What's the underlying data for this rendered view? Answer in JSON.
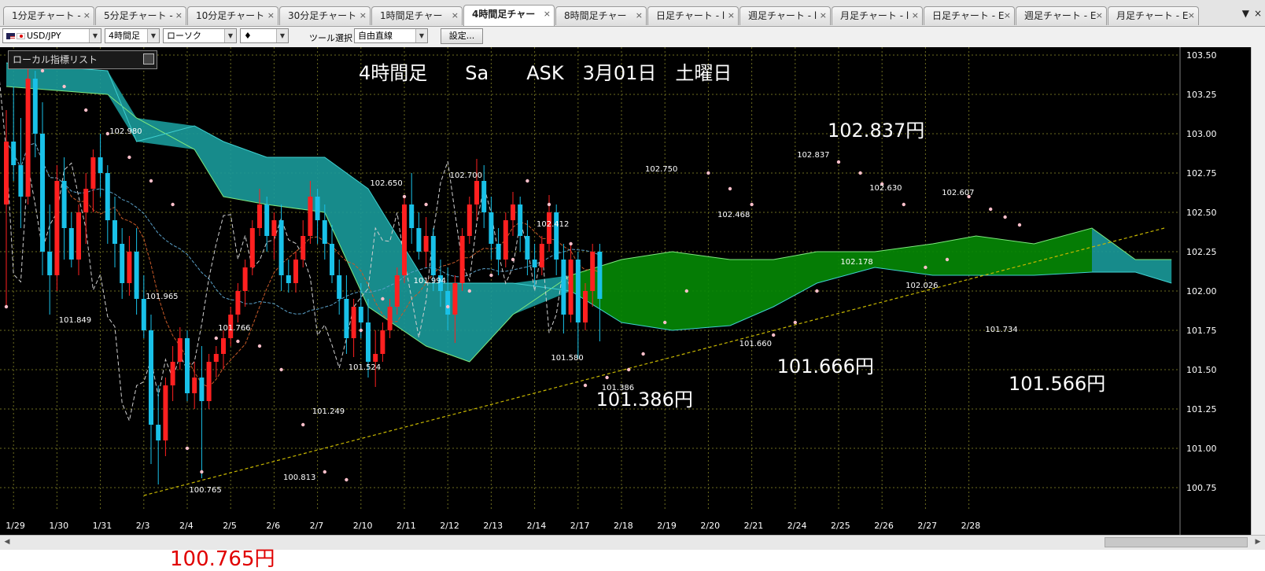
{
  "tabs": [
    {
      "label": "1分足チャート -",
      "active": false
    },
    {
      "label": "5分足チャート -",
      "active": false
    },
    {
      "label": "10分足チャート",
      "active": false
    },
    {
      "label": "30分足チャート",
      "active": false
    },
    {
      "label": "1時間足チャー",
      "active": false
    },
    {
      "label": "4時間足チャー",
      "active": true
    },
    {
      "label": "8時間足チャー",
      "active": false
    },
    {
      "label": "日足チャート - l",
      "active": false
    },
    {
      "label": "週足チャート - l",
      "active": false
    },
    {
      "label": "月足チャート - l",
      "active": false
    },
    {
      "label": "日足チャート - E",
      "active": false
    },
    {
      "label": "週足チャート - E",
      "active": false
    },
    {
      "label": "月足チャート - E",
      "active": false
    }
  ],
  "tab_close_glyph": "×",
  "tab_menu": {
    "menu_glyph": "▼",
    "close_glyph": "×"
  },
  "toolbar": {
    "pair": "USD/JPY",
    "timeframe": "4時間足",
    "chart_style": "ローソク",
    "marker": "♦",
    "tool_label": "ツール選択",
    "tool_value": "自由直線",
    "settings_label": "設定..."
  },
  "indicator_list": {
    "label": "ローカル指標リスト"
  },
  "below_chart_label": "100.765円",
  "colors": {
    "background": "#000000",
    "grid": "#6b6b1f",
    "candle_up": "#ff2020",
    "candle_down": "#19c1e8",
    "kumo_bearish": "#1a9a9a",
    "kumo_bullish": "#058a05",
    "sar": "#ffc0cb",
    "trendline": "#c8b800"
  },
  "chart_data": {
    "type": "candlestick",
    "title": "4時間足　　Sa　　ASK　3月01日　土曜日",
    "ylim": [
      100.6,
      103.55
    ],
    "yticks": [
      103.5,
      103.25,
      103.0,
      102.75,
      102.5,
      102.25,
      102.0,
      101.75,
      101.5,
      101.25,
      101.0,
      100.75
    ],
    "ytick_labels": [
      "103.50",
      "103.25",
      "103.00",
      "102.75",
      "102.50",
      "102.25",
      "102.00",
      "101.75",
      "101.50",
      "101.25",
      "101.00",
      "100.75"
    ],
    "xtick_labels": [
      "1/29",
      "1/30",
      "1/31",
      "2/3",
      "2/4",
      "2/5",
      "2/6",
      "2/7",
      "2/10",
      "2/11",
      "2/12",
      "2/13",
      "2/14",
      "2/17",
      "2/18",
      "2/19",
      "2/20",
      "2/21",
      "2/24",
      "2/25",
      "2/26",
      "2/27",
      "2/28"
    ],
    "xtick_pos": [
      1,
      7,
      13,
      19,
      25,
      31,
      37,
      43,
      49,
      55,
      61,
      67,
      73,
      79,
      85,
      91,
      97,
      103,
      109,
      115,
      121,
      127,
      133
    ],
    "ohlc": [
      [
        102.55,
        103.15,
        101.9,
        102.95
      ],
      [
        102.95,
        103.3,
        102.7,
        102.8
      ],
      [
        102.8,
        103.1,
        102.4,
        102.6
      ],
      [
        102.6,
        103.45,
        102.55,
        103.35
      ],
      [
        103.35,
        103.4,
        102.85,
        103.0
      ],
      [
        103.0,
        103.2,
        102.1,
        102.25
      ],
      [
        102.25,
        102.55,
        101.85,
        102.1
      ],
      [
        102.1,
        102.8,
        102.0,
        102.7
      ],
      [
        102.7,
        102.85,
        102.2,
        102.4
      ],
      [
        102.4,
        102.5,
        102.15,
        102.2
      ],
      [
        102.2,
        102.55,
        102.1,
        102.5
      ],
      [
        102.5,
        102.75,
        102.3,
        102.65
      ],
      [
        102.65,
        102.9,
        102.5,
        102.85
      ],
      [
        102.85,
        103.0,
        102.6,
        102.75
      ],
      [
        102.75,
        102.8,
        102.3,
        102.45
      ],
      [
        102.45,
        102.6,
        102.15,
        102.3
      ],
      [
        102.3,
        102.4,
        101.95,
        102.05
      ],
      [
        102.05,
        102.35,
        101.97,
        102.25
      ],
      [
        102.25,
        102.4,
        101.85,
        101.95
      ],
      [
        101.95,
        102.1,
        101.7,
        101.75
      ],
      [
        101.75,
        101.85,
        100.9,
        101.15
      ],
      [
        101.15,
        101.4,
        100.77,
        101.05
      ],
      [
        101.05,
        101.45,
        100.95,
        101.4
      ],
      [
        101.4,
        101.65,
        101.3,
        101.55
      ],
      [
        101.55,
        101.77,
        101.5,
        101.7
      ],
      [
        101.7,
        101.75,
        101.3,
        101.35
      ],
      [
        101.35,
        101.55,
        101.25,
        101.45
      ],
      [
        101.45,
        101.65,
        100.81,
        101.3
      ],
      [
        101.3,
        101.6,
        101.25,
        101.55
      ],
      [
        101.55,
        101.65,
        101.45,
        101.6
      ],
      [
        101.6,
        101.75,
        101.5,
        101.7
      ],
      [
        101.7,
        101.9,
        101.65,
        101.85
      ],
      [
        101.85,
        102.05,
        101.8,
        102.0
      ],
      [
        102.0,
        102.2,
        101.9,
        102.15
      ],
      [
        102.15,
        102.45,
        102.1,
        102.4
      ],
      [
        102.4,
        102.65,
        102.35,
        102.55
      ],
      [
        102.55,
        102.6,
        102.25,
        102.35
      ],
      [
        102.35,
        102.5,
        102.2,
        102.45
      ],
      [
        102.45,
        102.55,
        102.0,
        102.1
      ],
      [
        102.1,
        102.2,
        101.99,
        102.05
      ],
      [
        102.05,
        102.25,
        101.99,
        102.2
      ],
      [
        102.2,
        102.45,
        102.15,
        102.35
      ],
      [
        102.35,
        102.7,
        102.3,
        102.6
      ],
      [
        102.6,
        102.65,
        102.3,
        102.45
      ],
      [
        102.45,
        102.55,
        102.2,
        102.3
      ],
      [
        102.3,
        102.42,
        102.05,
        102.1
      ],
      [
        102.1,
        102.2,
        101.85,
        101.95
      ],
      [
        101.95,
        102.1,
        101.6,
        101.7
      ],
      [
        101.7,
        101.95,
        101.58,
        101.9
      ],
      [
        101.9,
        102.05,
        101.7,
        101.8
      ],
      [
        101.8,
        101.95,
        101.45,
        101.55
      ],
      [
        101.55,
        101.75,
        101.39,
        101.6
      ],
      [
        101.6,
        101.8,
        101.55,
        101.75
      ],
      [
        101.75,
        101.95,
        101.7,
        101.9
      ],
      [
        101.9,
        102.15,
        101.85,
        102.1
      ],
      [
        102.1,
        102.6,
        102.05,
        102.55
      ],
      [
        102.55,
        102.75,
        102.3,
        102.4
      ],
      [
        102.4,
        102.5,
        102.2,
        102.25
      ],
      [
        102.25,
        102.47,
        102.15,
        102.35
      ],
      [
        102.35,
        102.4,
        102.0,
        102.1
      ],
      [
        102.1,
        102.2,
        101.9,
        102.0
      ],
      [
        102.0,
        102.15,
        101.75,
        101.85
      ],
      [
        101.85,
        102.1,
        101.67,
        102.05
      ],
      [
        102.05,
        102.4,
        102.0,
        102.35
      ],
      [
        102.35,
        102.6,
        102.3,
        102.55
      ],
      [
        102.55,
        102.84,
        102.45,
        102.7
      ],
      [
        102.7,
        102.8,
        102.4,
        102.5
      ],
      [
        102.5,
        102.6,
        102.2,
        102.3
      ],
      [
        102.3,
        102.4,
        102.1,
        102.2
      ],
      [
        102.2,
        102.5,
        102.15,
        102.45
      ],
      [
        102.45,
        102.63,
        102.35,
        102.55
      ],
      [
        102.55,
        102.6,
        102.25,
        102.35
      ],
      [
        102.35,
        102.45,
        102.1,
        102.2
      ],
      [
        102.2,
        102.3,
        102.03,
        102.15
      ],
      [
        102.15,
        102.35,
        102.1,
        102.3
      ],
      [
        102.3,
        102.61,
        102.25,
        102.5
      ],
      [
        102.5,
        102.55,
        102.1,
        102.2
      ],
      [
        102.2,
        102.3,
        101.73,
        101.85
      ],
      [
        101.85,
        102.3,
        101.8,
        102.2
      ],
      [
        102.2,
        102.25,
        101.57,
        101.8
      ],
      [
        101.8,
        102.05,
        101.75,
        102.0
      ],
      [
        102.0,
        102.3,
        101.9,
        102.25
      ],
      [
        102.25,
        102.3,
        101.68,
        101.95
      ]
    ],
    "ichimoku_cloud": [
      {
        "x": 0,
        "a": 103.3,
        "b": 103.45
      },
      {
        "x": 14,
        "a": 103.25,
        "b": 103.4
      },
      {
        "x": 18,
        "a": 103.1,
        "b": 102.95
      },
      {
        "x": 26,
        "a": 102.9,
        "b": 103.05
      },
      {
        "x": 30,
        "a": 102.6,
        "b": 102.95
      },
      {
        "x": 36,
        "a": 102.55,
        "b": 102.85
      },
      {
        "x": 44,
        "a": 102.5,
        "b": 102.85
      },
      {
        "x": 50,
        "a": 101.9,
        "b": 102.65
      },
      {
        "x": 58,
        "a": 101.65,
        "b": 102.05
      },
      {
        "x": 64,
        "a": 101.55,
        "b": 102.05
      },
      {
        "x": 70,
        "a": 101.85,
        "b": 102.05
      },
      {
        "x": 78,
        "a": 102.1,
        "b": 102.0
      },
      {
        "x": 85,
        "a": 102.2,
        "b": 101.8
      },
      {
        "x": 92,
        "a": 102.25,
        "b": 101.75
      },
      {
        "x": 100,
        "a": 102.2,
        "b": 101.78
      },
      {
        "x": 106,
        "a": 102.2,
        "b": 101.9
      },
      {
        "x": 112,
        "a": 102.25,
        "b": 102.05
      },
      {
        "x": 120,
        "a": 102.25,
        "b": 102.15
      },
      {
        "x": 128,
        "a": 102.3,
        "b": 102.1
      },
      {
        "x": 134,
        "a": 102.35,
        "b": 102.1
      },
      {
        "x": 142,
        "a": 102.3,
        "b": 102.1
      },
      {
        "x": 150,
        "a": 102.4,
        "b": 102.12
      },
      {
        "x": 156,
        "a": 102.2,
        "b": 102.12
      },
      {
        "x": 161,
        "a": 102.2,
        "b": 102.05
      }
    ],
    "parabolic_sar": [
      [
        0,
        101.9
      ],
      [
        2,
        103.45
      ],
      [
        5,
        103.4
      ],
      [
        8,
        103.3
      ],
      [
        11,
        103.15
      ],
      [
        14,
        103.0
      ],
      [
        17,
        102.85
      ],
      [
        20,
        102.7
      ],
      [
        23,
        102.55
      ],
      [
        25,
        101.0
      ],
      [
        27,
        100.85
      ],
      [
        29,
        101.7
      ],
      [
        32,
        101.68
      ],
      [
        35,
        101.65
      ],
      [
        38,
        101.5
      ],
      [
        41,
        101.15
      ],
      [
        44,
        100.85
      ],
      [
        47,
        100.8
      ],
      [
        49,
        101.75
      ],
      [
        52,
        101.95
      ],
      [
        55,
        102.6
      ],
      [
        58,
        102.55
      ],
      [
        61,
        101.9
      ],
      [
        64,
        102.0
      ],
      [
        67,
        102.1
      ],
      [
        70,
        102.2
      ],
      [
        72,
        102.7
      ],
      [
        75,
        102.55
      ],
      [
        78,
        102.3
      ],
      [
        80,
        101.4
      ],
      [
        83,
        101.45
      ],
      [
        86,
        101.5
      ],
      [
        88,
        101.6
      ],
      [
        91,
        101.8
      ],
      [
        94,
        102.0
      ],
      [
        97,
        102.75
      ],
      [
        100,
        102.65
      ],
      [
        103,
        102.55
      ],
      [
        106,
        101.72
      ],
      [
        109,
        101.8
      ],
      [
        112,
        102.0
      ],
      [
        115,
        102.82
      ],
      [
        118,
        102.75
      ],
      [
        121,
        102.68
      ],
      [
        124,
        102.55
      ],
      [
        127,
        102.15
      ],
      [
        130,
        102.2
      ],
      [
        133,
        102.6
      ],
      [
        136,
        102.52
      ],
      [
        138,
        102.47
      ],
      [
        140,
        102.42
      ]
    ],
    "trendline": {
      "from": [
        19,
        100.7
      ],
      "to": [
        160,
        102.4
      ]
    },
    "price_labels": [
      {
        "x": 9,
        "y": 101.8,
        "text": "101.849"
      },
      {
        "x": 16,
        "y": 103.0,
        "text": "102.980"
      },
      {
        "x": 21,
        "y": 101.95,
        "text": "101.965"
      },
      {
        "x": 31,
        "y": 101.75,
        "text": "101.766"
      },
      {
        "x": 27,
        "y": 100.72,
        "text": "100.765"
      },
      {
        "x": 40,
        "y": 100.8,
        "text": "100.813"
      },
      {
        "x": 44,
        "y": 101.22,
        "text": "101.249"
      },
      {
        "x": 49,
        "y": 101.5,
        "text": "101.524"
      },
      {
        "x": 52,
        "y": 102.67,
        "text": "102.650"
      },
      {
        "x": 58,
        "y": 102.05,
        "text": "101.994"
      },
      {
        "x": 63,
        "y": 102.72,
        "text": "102.700"
      },
      {
        "x": 75,
        "y": 102.41,
        "text": "102.412"
      },
      {
        "x": 77,
        "y": 101.56,
        "text": "101.580"
      },
      {
        "x": 84,
        "y": 101.37,
        "text": "101.386"
      },
      {
        "x": 90,
        "y": 102.76,
        "text": "102.750"
      },
      {
        "x": 100,
        "y": 102.47,
        "text": "102.468"
      },
      {
        "x": 103,
        "y": 101.65,
        "text": "101.660"
      },
      {
        "x": 111,
        "y": 102.85,
        "text": "102.837"
      },
      {
        "x": 117,
        "y": 102.17,
        "text": "102.178"
      },
      {
        "x": 121,
        "y": 102.64,
        "text": "102.630"
      },
      {
        "x": 126,
        "y": 102.02,
        "text": "102.026"
      },
      {
        "x": 131,
        "y": 102.61,
        "text": "102.607"
      },
      {
        "x": 137,
        "y": 101.74,
        "text": "101.734"
      }
    ],
    "big_labels": [
      {
        "x": 120,
        "y": 102.98,
        "text": "102.837円"
      },
      {
        "x": 88,
        "y": 101.27,
        "text": "101.386円"
      },
      {
        "x": 113,
        "y": 101.48,
        "text": "101.666円"
      },
      {
        "x": 145,
        "y": 101.37,
        "text": "101.566円"
      }
    ]
  }
}
